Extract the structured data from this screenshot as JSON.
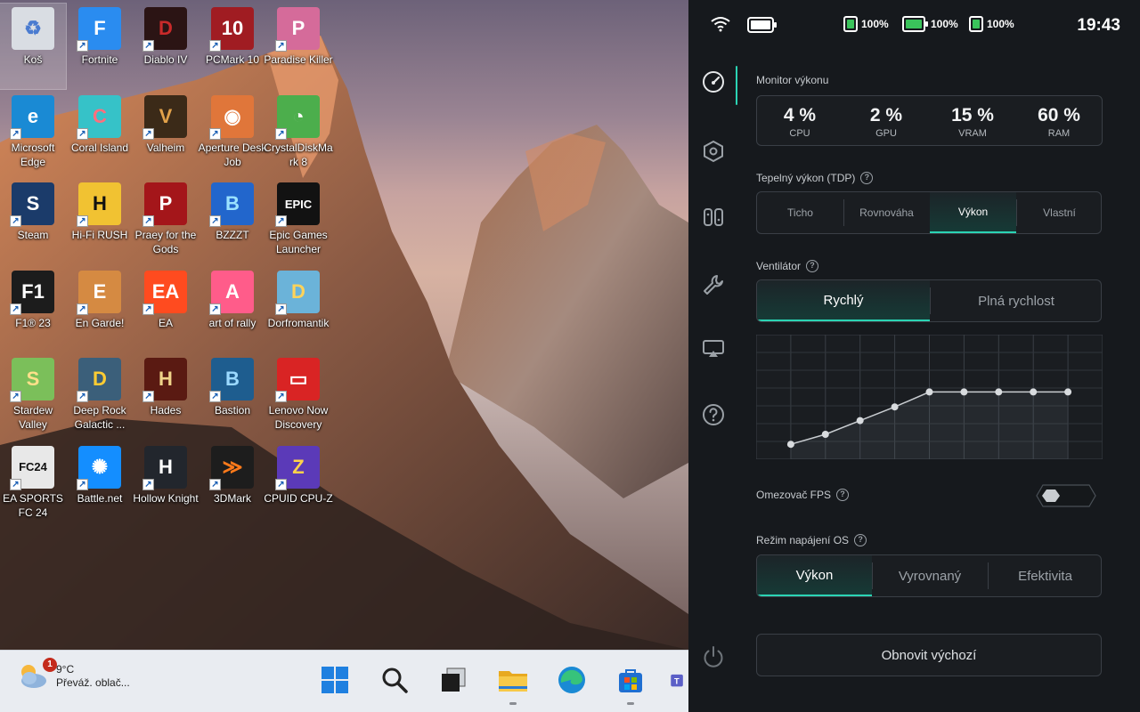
{
  "desktop": {
    "icons": [
      {
        "label": "Koš",
        "glyph": "♻",
        "color": "#d9dde3",
        "fg": "#4a7bd0"
      },
      {
        "label": "Fortnite",
        "glyph": "F",
        "color": "#2a8cf0",
        "fg": "#ffffff"
      },
      {
        "label": "Diablo IV",
        "glyph": "D",
        "color": "#2b1414",
        "fg": "#c92a2a"
      },
      {
        "label": "PCMark 10",
        "glyph": "10",
        "color": "#a01c22",
        "fg": "#ffffff"
      },
      {
        "label": "Paradise Killer",
        "glyph": "P",
        "color": "#d56b9a",
        "fg": "#ffffff"
      },
      {
        "label": "Microsoft Edge",
        "glyph": "e",
        "color": "#1a8ad4",
        "fg": "#ffffff"
      },
      {
        "label": "Coral Island",
        "glyph": "C",
        "color": "#36c2c8",
        "fg": "#ff6f7d"
      },
      {
        "label": "Valheim",
        "glyph": "V",
        "color": "#3b2a18",
        "fg": "#e2a24a"
      },
      {
        "label": "Aperture Desk Job",
        "glyph": "◉",
        "color": "#e0763a",
        "fg": "#ffffff"
      },
      {
        "label": "CrystalDiskMark 8",
        "glyph": "◔",
        "color": "#4cae4c",
        "fg": "#ffffff"
      },
      {
        "label": "Steam",
        "glyph": "S",
        "color": "#1b3b6a",
        "fg": "#ffffff"
      },
      {
        "label": "Hi-Fi RUSH",
        "glyph": "H",
        "color": "#f1c232",
        "fg": "#111111"
      },
      {
        "label": "Praey for the Gods",
        "glyph": "P",
        "color": "#a4161a",
        "fg": "#ffffff"
      },
      {
        "label": "BZZZT",
        "glyph": "B",
        "color": "#2266cc",
        "fg": "#9be2ff"
      },
      {
        "label": "Epic Games Launcher",
        "glyph": "EPIC",
        "color": "#121212",
        "fg": "#ffffff"
      },
      {
        "label": "F1® 23",
        "glyph": "F1",
        "color": "#1c1c1c",
        "fg": "#ffffff"
      },
      {
        "label": "En Garde!",
        "glyph": "E",
        "color": "#d58a42",
        "fg": "#ffffff"
      },
      {
        "label": "EA",
        "glyph": "EA",
        "color": "#ff4b1f",
        "fg": "#ffffff"
      },
      {
        "label": "art of rally",
        "glyph": "A",
        "color": "#ff5c8a",
        "fg": "#ffffff"
      },
      {
        "label": "Dorfromantik",
        "glyph": "D",
        "color": "#6bb3d9",
        "fg": "#ffd35a"
      },
      {
        "label": "Stardew Valley",
        "glyph": "S",
        "color": "#7bbf5a",
        "fg": "#ffe08a"
      },
      {
        "label": "Deep Rock Galactic ...",
        "glyph": "D",
        "color": "#3b5f7a",
        "fg": "#ffcc33"
      },
      {
        "label": "Hades",
        "glyph": "H",
        "color": "#5a1a12",
        "fg": "#f0d48a"
      },
      {
        "label": "Bastion",
        "glyph": "B",
        "color": "#1e5d8f",
        "fg": "#9bd9ff"
      },
      {
        "label": "Lenovo Now Discovery",
        "glyph": "▭",
        "color": "#d92424",
        "fg": "#ffffff"
      },
      {
        "label": "EA SPORTS FC 24",
        "glyph": "FC24",
        "color": "#e8e8e8",
        "fg": "#111111"
      },
      {
        "label": "Battle.net",
        "glyph": "✺",
        "color": "#148eff",
        "fg": "#ffffff"
      },
      {
        "label": "Hollow Knight",
        "glyph": "H",
        "color": "#22262d",
        "fg": "#ffffff"
      },
      {
        "label": "3DMark",
        "glyph": "≫",
        "color": "#1d1d1d",
        "fg": "#ff7a1a"
      },
      {
        "label": "CPUID CPU-Z",
        "glyph": "Z",
        "color": "#5b3ab8",
        "fg": "#ffd24a"
      }
    ]
  },
  "taskbar": {
    "weather_temp": "9°C",
    "weather_desc": "Převáž. oblač...",
    "weather_badge": "1"
  },
  "status": {
    "battery1": "100%",
    "battery2": "100%",
    "battery3": "100%",
    "clock": "19:43"
  },
  "monitor": {
    "title": "Monitor výkonu",
    "stats": [
      {
        "value": "4 %",
        "label": "CPU"
      },
      {
        "value": "2 %",
        "label": "GPU"
      },
      {
        "value": "15 %",
        "label": "VRAM"
      },
      {
        "value": "60 %",
        "label": "RAM"
      }
    ]
  },
  "tdp": {
    "title": "Tepelný výkon (TDP)",
    "options": [
      "Ticho",
      "Rovnováha",
      "Výkon",
      "Vlastní"
    ],
    "active": 2
  },
  "fan": {
    "title": "Ventilátor",
    "options": [
      "Rychlý",
      "Plná rychlost"
    ],
    "active": 0,
    "curve": [
      0.12,
      0.2,
      0.31,
      0.42,
      0.54,
      0.54,
      0.54,
      0.54,
      0.54
    ]
  },
  "fps_limiter": {
    "title": "Omezovač FPS",
    "enabled": false
  },
  "os_power": {
    "title": "Režim napájení OS",
    "options": [
      "Výkon",
      "Vyrovnaný",
      "Efektivita"
    ],
    "active": 0
  },
  "reset_label": "Obnovit výchozí",
  "help_glyph": "?",
  "colors": {
    "accent": "#2bd4b4",
    "panel_bg": "#16191d",
    "battery_green": "#3ac35b"
  }
}
